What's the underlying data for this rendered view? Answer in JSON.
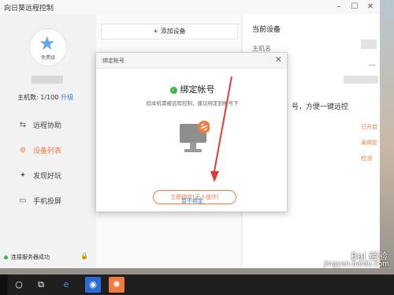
{
  "window": {
    "title": "向日葵远程控制",
    "minimize": "–",
    "maximize": "☐",
    "close": "✕"
  },
  "sidebar": {
    "plan_label": "免费级",
    "host_count": "主机数: 1/100",
    "upgrade_label": "升级",
    "items": [
      {
        "label": "远程协助",
        "icon": "remote-assist-icon"
      },
      {
        "label": "设备列表",
        "icon": "device-list-icon"
      },
      {
        "label": "发现好玩",
        "icon": "discover-icon"
      },
      {
        "label": "手机投屏",
        "icon": "phone-cast-icon"
      }
    ],
    "status_text": "连接服务器成功"
  },
  "center": {
    "add_device_label": "+ 添加设备"
  },
  "right": {
    "title": "当前设备",
    "hostname_label": "主机名",
    "dashes": "---",
    "promo_text": "号，方便一键远控",
    "statuses": [
      "已开启",
      "未绑定",
      "检测"
    ]
  },
  "modal": {
    "title": "绑定帐号",
    "close": "✕",
    "heading": "绑定帐号",
    "description": "如本机需被远程控制，建议绑定到帐号下",
    "bind_button": "立即绑定(无人值守)",
    "skip_link": "暂不绑定"
  },
  "watermark": {
    "logo": "Bai 经验",
    "site": "jingyan.baidu.com"
  },
  "colors": {
    "accent": "#f07b3f",
    "link": "#2f7fd9",
    "success": "#3bb34a"
  }
}
